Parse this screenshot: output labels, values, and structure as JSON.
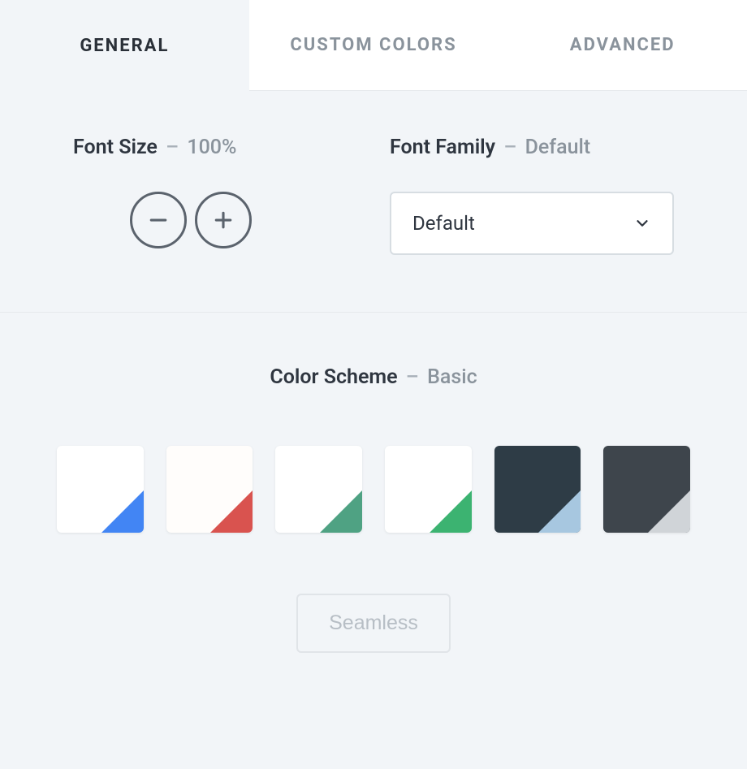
{
  "tabs": {
    "general": "GENERAL",
    "custom_colors": "CUSTOM COLORS",
    "advanced": "ADVANCED"
  },
  "font_size": {
    "label": "Font Size",
    "value": "100%"
  },
  "font_family": {
    "label": "Font Family",
    "value": "Default",
    "selected": "Default"
  },
  "color_scheme": {
    "label": "Color Scheme",
    "value": "Basic",
    "swatches": [
      {
        "bg": "#ffffff",
        "accent": "#4285f4"
      },
      {
        "bg": "#fffdfb",
        "accent": "#d9534f"
      },
      {
        "bg": "#ffffff",
        "accent": "#4fa283"
      },
      {
        "bg": "#ffffff",
        "accent": "#3cb371"
      },
      {
        "bg": "#2e3c46",
        "accent": "#a7c7e0"
      },
      {
        "bg": "#3e454c",
        "accent": "#d0d4d8"
      }
    ],
    "seamless_label": "Seamless"
  }
}
